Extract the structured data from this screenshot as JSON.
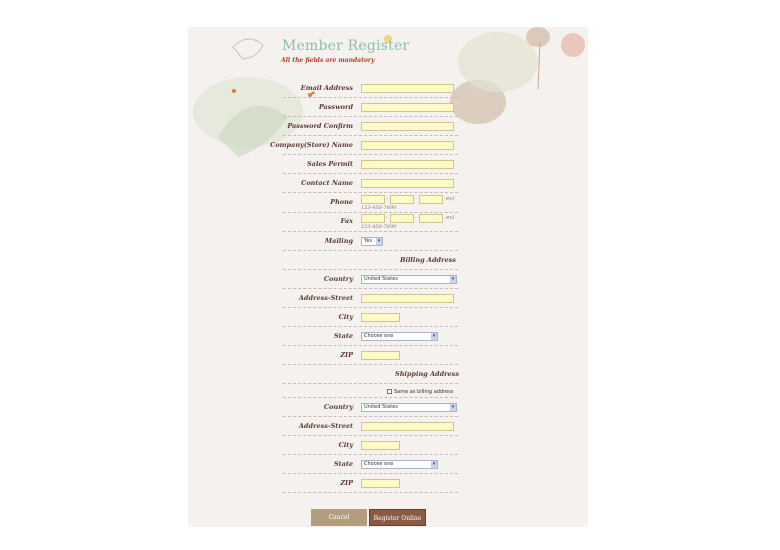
{
  "header": {
    "title": "Member Register",
    "subtitle": "All the fields are mandatory"
  },
  "fields": {
    "email": "Email Address",
    "password": "Password",
    "password_confirm": "Password Confirm",
    "company": "Company(Store) Name",
    "sales_permit": "Sales Permit",
    "contact_name": "Contact Name",
    "phone": "Phone",
    "fax": "Fax",
    "mailing": "Mailing"
  },
  "phone": {
    "ex": "ex)",
    "hint": "123-456-7890",
    "sep": "-"
  },
  "fax": {
    "ex": "ex)",
    "hint": "123-456-7890",
    "sep": "-"
  },
  "mailing_value": "Yes",
  "billing": {
    "title": "Billing Address",
    "country_label": "Country",
    "country_value": "United States",
    "street_label": "Address-Street",
    "city_label": "City",
    "state_label": "State",
    "state_value": "Choose one",
    "zip_label": "ZIP"
  },
  "shipping": {
    "title": "Shipping Address",
    "same_as_billing": "Same as billing address",
    "country_label": "Country",
    "country_value": "United States",
    "street_label": "Address-Street",
    "city_label": "City",
    "state_label": "State",
    "state_value": "Choose one",
    "zip_label": "ZIP"
  },
  "buttons": {
    "cancel": "Cancel",
    "register": "Register Online"
  },
  "colors": {
    "title": "#8fbcae",
    "subtitle": "#c0392b",
    "input_bg": "#fffbc6",
    "cancel_bg": "#b39d7f",
    "register_bg": "#8b5a45"
  }
}
